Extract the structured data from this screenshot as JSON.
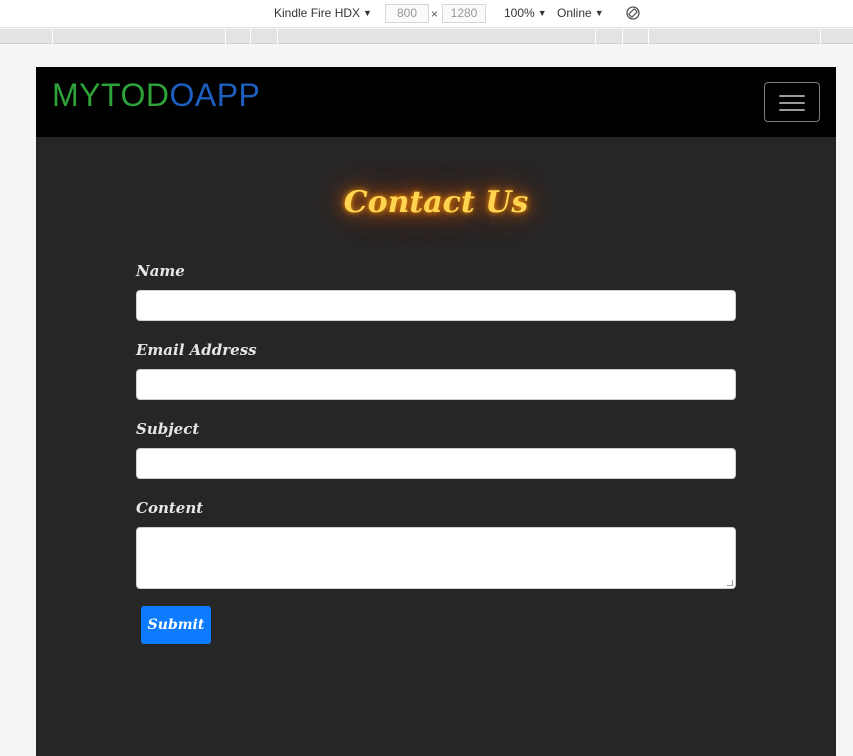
{
  "devtools": {
    "device": "Kindle Fire HDX",
    "width": "800",
    "times": "×",
    "height": "1280",
    "zoom": "100%",
    "network": "Online",
    "caret": "▼",
    "rotate_icon": "rotate-icon"
  },
  "navbar": {
    "brand_part1": "MYTOD",
    "brand_part2": "OAPP",
    "menu_icon": "hamburger-menu-icon"
  },
  "contact": {
    "heading": "Contact Us",
    "name_label": "Name",
    "email_label": "Email Address",
    "subject_label": "Subject",
    "content_label": "Content",
    "submit_label": "Submit"
  },
  "colors": {
    "brand_green": "#2ea339",
    "brand_blue": "#1c5fbf",
    "heading_glow": "#ffd451",
    "page_bg": "#272626",
    "submit_bg": "#0d7bff"
  }
}
